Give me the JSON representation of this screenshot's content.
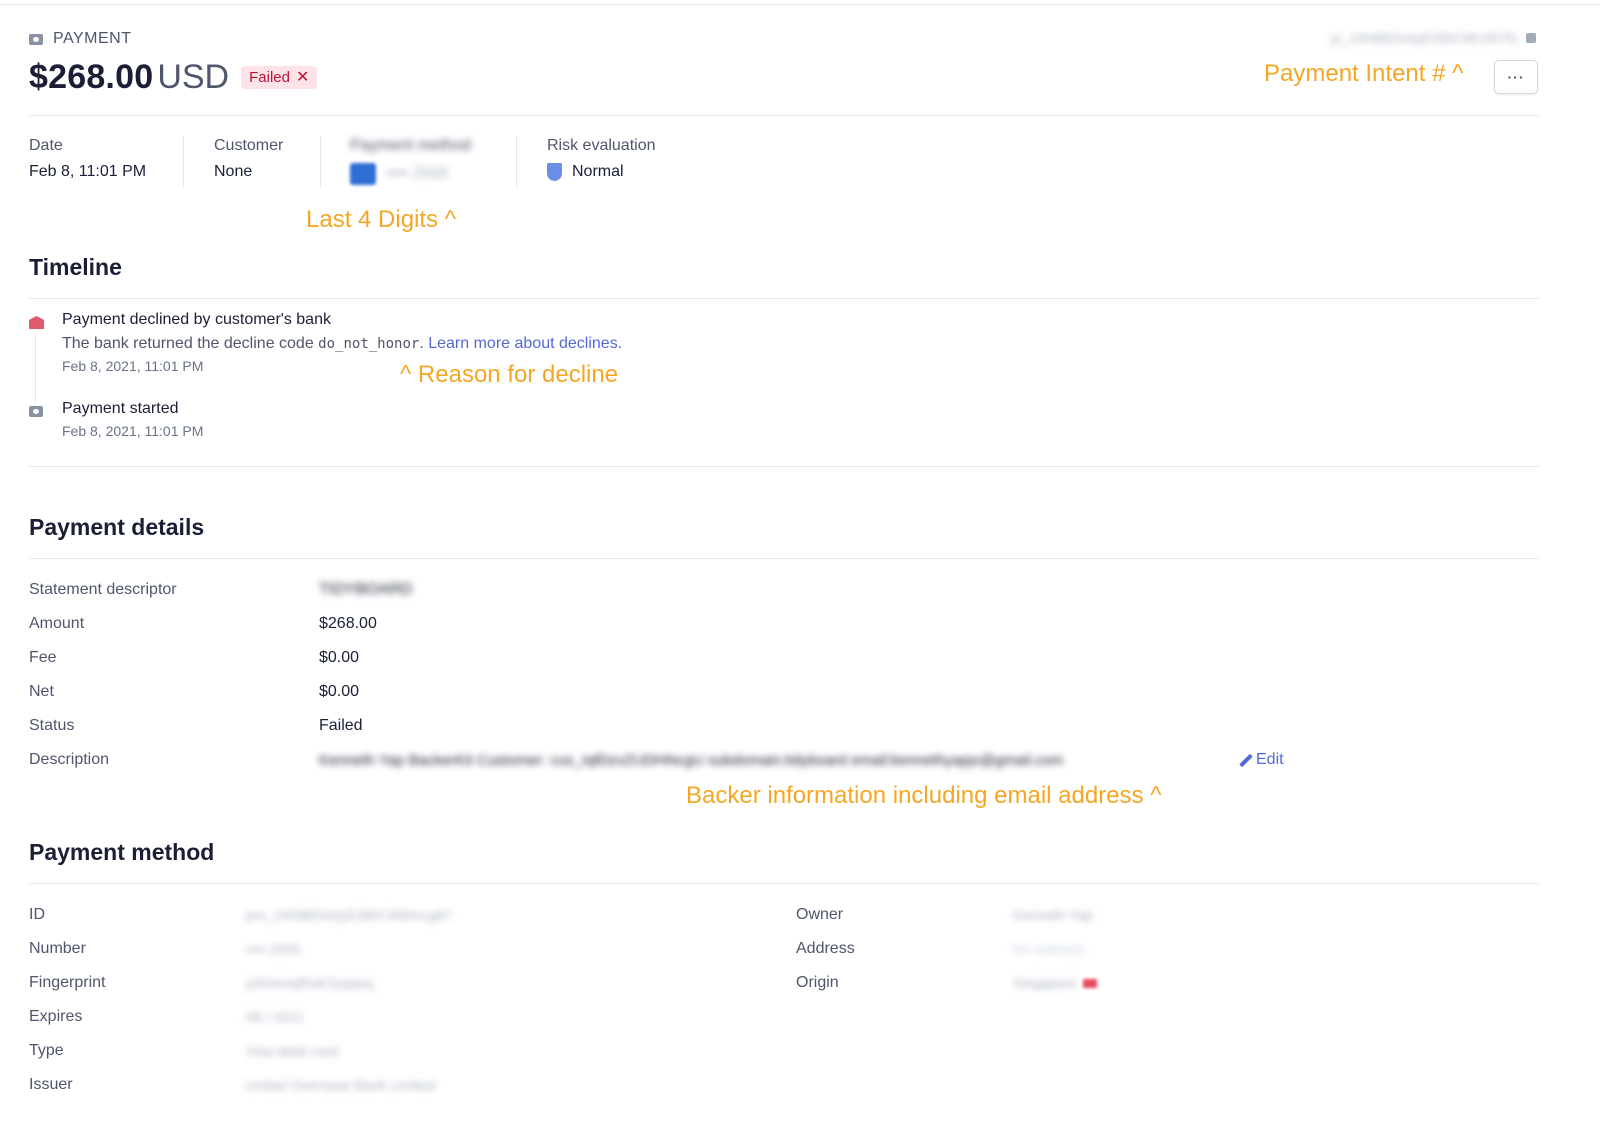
{
  "header": {
    "kicker": "PAYMENT",
    "amount": "$268.00",
    "currency": "USD",
    "status_badge": "Failed",
    "payment_intent_id": "pi_1IIh8BGIvtyE2BIC9KXR7fv",
    "more_icon": "···"
  },
  "annotations": {
    "payment_intent": "Payment Intent # ^",
    "last4": "Last 4 Digits ^",
    "reason": "^ Reason for decline",
    "backer": "Backer information including email address ^"
  },
  "summary": {
    "date_label": "Date",
    "date_value": "Feb 8, 11:01 PM",
    "customer_label": "Customer",
    "customer_value": "None",
    "method_label": "Payment method",
    "method_value": "•••• 2500",
    "risk_label": "Risk evaluation",
    "risk_value": "Normal"
  },
  "timeline": {
    "title": "Timeline",
    "items": [
      {
        "title": "Payment declined by customer's bank",
        "message_prefix": "The bank returned the decline code ",
        "code": "do_not_honor",
        "message_suffix": ".",
        "link": "Learn more about declines.",
        "time": "Feb 8, 2021, 11:01 PM"
      },
      {
        "title": "Payment started",
        "time": "Feb 8, 2021, 11:01 PM"
      }
    ]
  },
  "payment_details": {
    "title": "Payment details",
    "rows": [
      {
        "label": "Statement descriptor",
        "value": "TIDYBOARD"
      },
      {
        "label": "Amount",
        "value": "$268.00"
      },
      {
        "label": "Fee",
        "value": "$0.00"
      },
      {
        "label": "Net",
        "value": "$0.00"
      },
      {
        "label": "Status",
        "value": "Failed"
      },
      {
        "label": "Description",
        "value": "Kenneth Yap BackerKit Customer: cus_IqfDzvZUDHNcgU subdomain:tidyboard email:kennethyapjx@gmail.com"
      }
    ],
    "edit_label": "Edit"
  },
  "payment_method": {
    "title": "Payment method",
    "left": [
      {
        "label": "ID",
        "value": "pm_1IIh8BGIvtyE2BIC3N0rrcg67"
      },
      {
        "label": "Number",
        "value": "•••• 2500"
      },
      {
        "label": "Fingerprint",
        "value": "p3Hmnqf5okTpqaeq"
      },
      {
        "label": "Expires",
        "value": "08 / 2021"
      },
      {
        "label": "Type",
        "value": "Visa debit card"
      },
      {
        "label": "Issuer",
        "value": "United Overseas Bank Limited"
      }
    ],
    "right": [
      {
        "label": "Owner",
        "value": "Kenneth Yap"
      },
      {
        "label": "Address",
        "value": "No address"
      },
      {
        "label": "Origin",
        "value": "Singapore"
      }
    ]
  }
}
